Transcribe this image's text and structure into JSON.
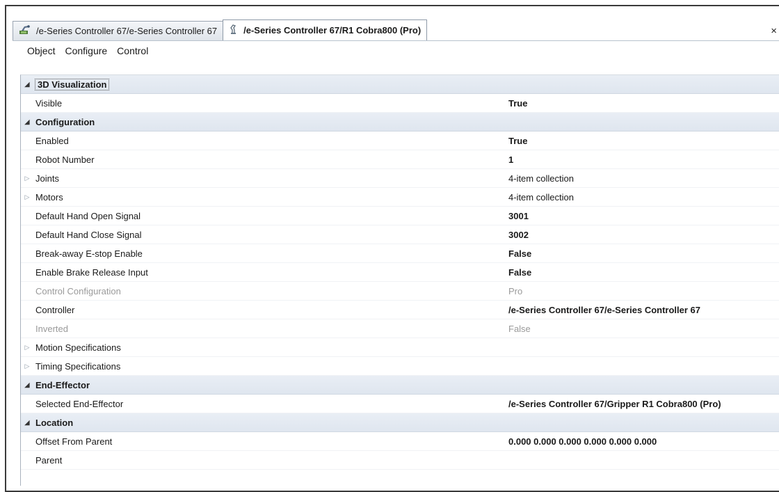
{
  "tabs": [
    {
      "label": "/e-Series Controller 67/e-Series Controller 67",
      "icon": "controller-icon",
      "active": false
    },
    {
      "label": "/e-Series Controller 67/R1 Cobra800 (Pro)",
      "icon": "robot-arm-icon",
      "active": true
    }
  ],
  "close_glyph": "×",
  "menu": [
    "Object",
    "Configure",
    "Control"
  ],
  "categories": [
    {
      "name": "3D Visualization",
      "properties": [
        {
          "name": "Visible",
          "value": "True"
        }
      ]
    },
    {
      "name": "Configuration",
      "properties": [
        {
          "name": "Enabled",
          "value": "True"
        },
        {
          "name": "Robot Number",
          "value": "1"
        },
        {
          "name": "Joints",
          "value": "4-item collection"
        },
        {
          "name": "Motors",
          "value": "4-item collection"
        },
        {
          "name": "Default Hand Open Signal",
          "value": "3001"
        },
        {
          "name": "Default Hand Close Signal",
          "value": "3002"
        },
        {
          "name": "Break-away E-stop Enable",
          "value": "False"
        },
        {
          "name": "Enable Brake Release Input",
          "value": "False"
        },
        {
          "name": "Control Configuration",
          "value": "Pro"
        },
        {
          "name": "Controller",
          "value": "/e-Series Controller 67/e-Series Controller 67"
        },
        {
          "name": "Inverted",
          "value": "False"
        },
        {
          "name": "Motion Specifications",
          "value": ""
        },
        {
          "name": "Timing Specifications",
          "value": ""
        }
      ]
    },
    {
      "name": "End-Effector",
      "properties": [
        {
          "name": "Selected End-Effector",
          "value": "/e-Series Controller 67/Gripper R1 Cobra800 (Pro)"
        }
      ]
    },
    {
      "name": "Location",
      "properties": [
        {
          "name": "Offset From Parent",
          "value": "0.000 0.000 0.000 0.000 0.000 0.000"
        },
        {
          "name": "Parent",
          "value": ""
        }
      ]
    }
  ]
}
